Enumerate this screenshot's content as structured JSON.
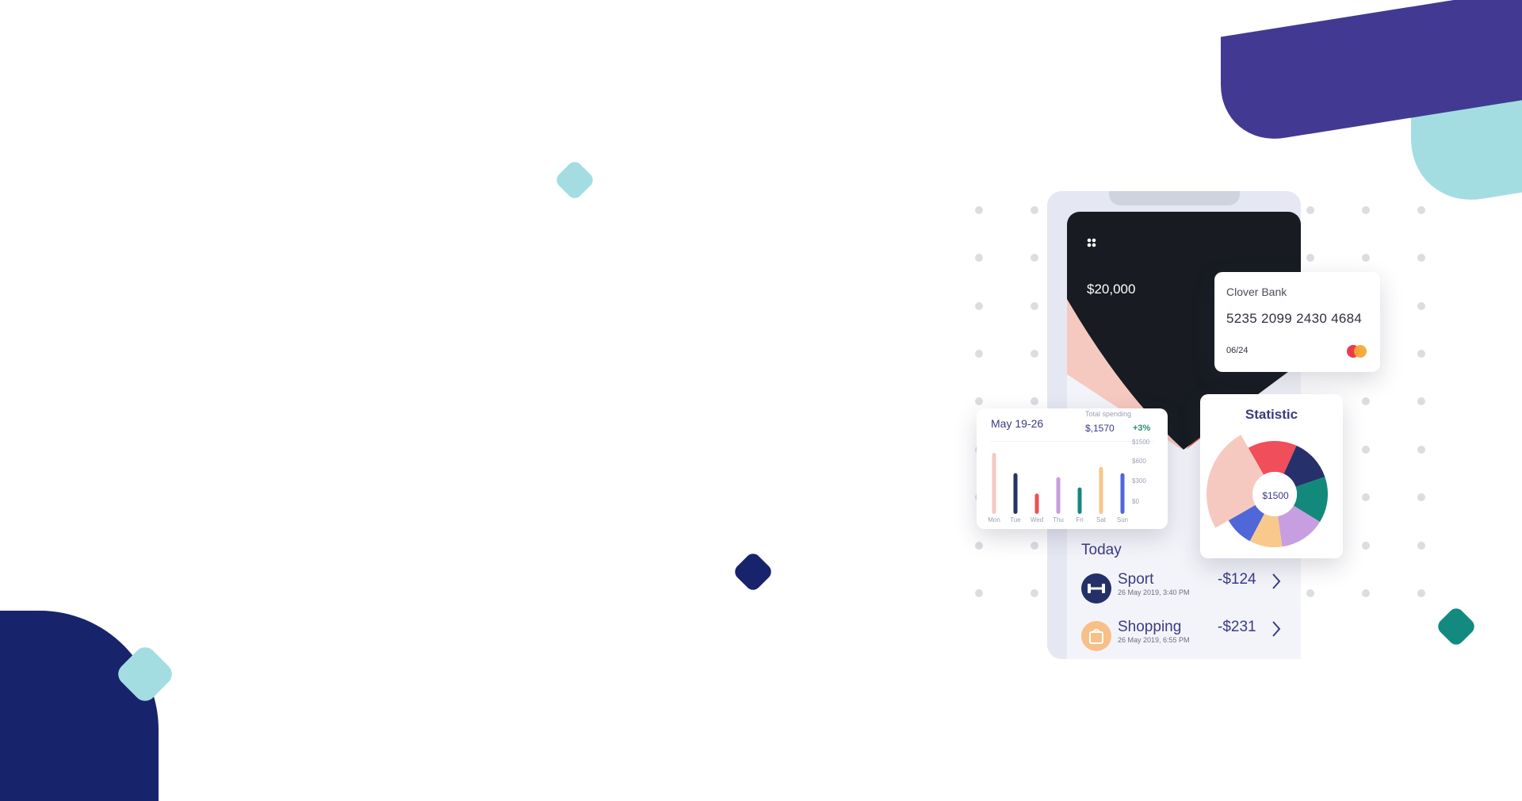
{
  "wallet": {
    "balance": "$20,000",
    "menu_icon": "four-dots-icon"
  },
  "bank_card": {
    "bank_name": "Clover Bank",
    "number": "5235 2099 2430 4684",
    "expiry": "06/24",
    "network_icon": "mastercard-icon"
  },
  "spending": {
    "date_range": "May 19-26",
    "total_label": "Total spending",
    "total": "$,1570",
    "change": "+3%",
    "change_color": "#2a8f6e",
    "y_ticks": [
      "$1500",
      "$600",
      "$300",
      "$0"
    ]
  },
  "statistic": {
    "title": "Statistic",
    "center": "$1500"
  },
  "today": {
    "title": "Today",
    "transactions": [
      {
        "title": "Sport",
        "date": "26 May 2019, 3:40 PM",
        "amount": "-$124",
        "icon": "dumbbell-icon",
        "icon_bg": "#23306a"
      },
      {
        "title": "Shopping",
        "date": "26 May 2019, 6:55 PM",
        "amount": "-$231",
        "icon": "shopping-bag-icon",
        "icon_bg": "#f6c088"
      }
    ]
  },
  "chart_data": [
    {
      "type": "bar",
      "categories": [
        "Mon",
        "Tue",
        "Wed",
        "Thu",
        "Fri",
        "Sat",
        "Sun"
      ],
      "values": [
        1500,
        1000,
        500,
        900,
        650,
        1150,
        1000
      ],
      "colors": [
        "#f6c9c0",
        "#26306a",
        "#f04e5a",
        "#c79ee0",
        "#13897c",
        "#f8c587",
        "#4f67d8"
      ],
      "ylim": [
        0,
        1500
      ]
    },
    {
      "type": "pie",
      "labels": [
        "",
        "",
        "",
        "",
        "",
        "",
        ""
      ],
      "values": [
        15,
        13,
        14,
        14,
        10,
        9,
        25
      ],
      "colors": [
        "#f04e5a",
        "#26306a",
        "#13897c",
        "#c79ee0",
        "#f8c98b",
        "#4f67d8",
        "#f6c9c0"
      ]
    }
  ]
}
